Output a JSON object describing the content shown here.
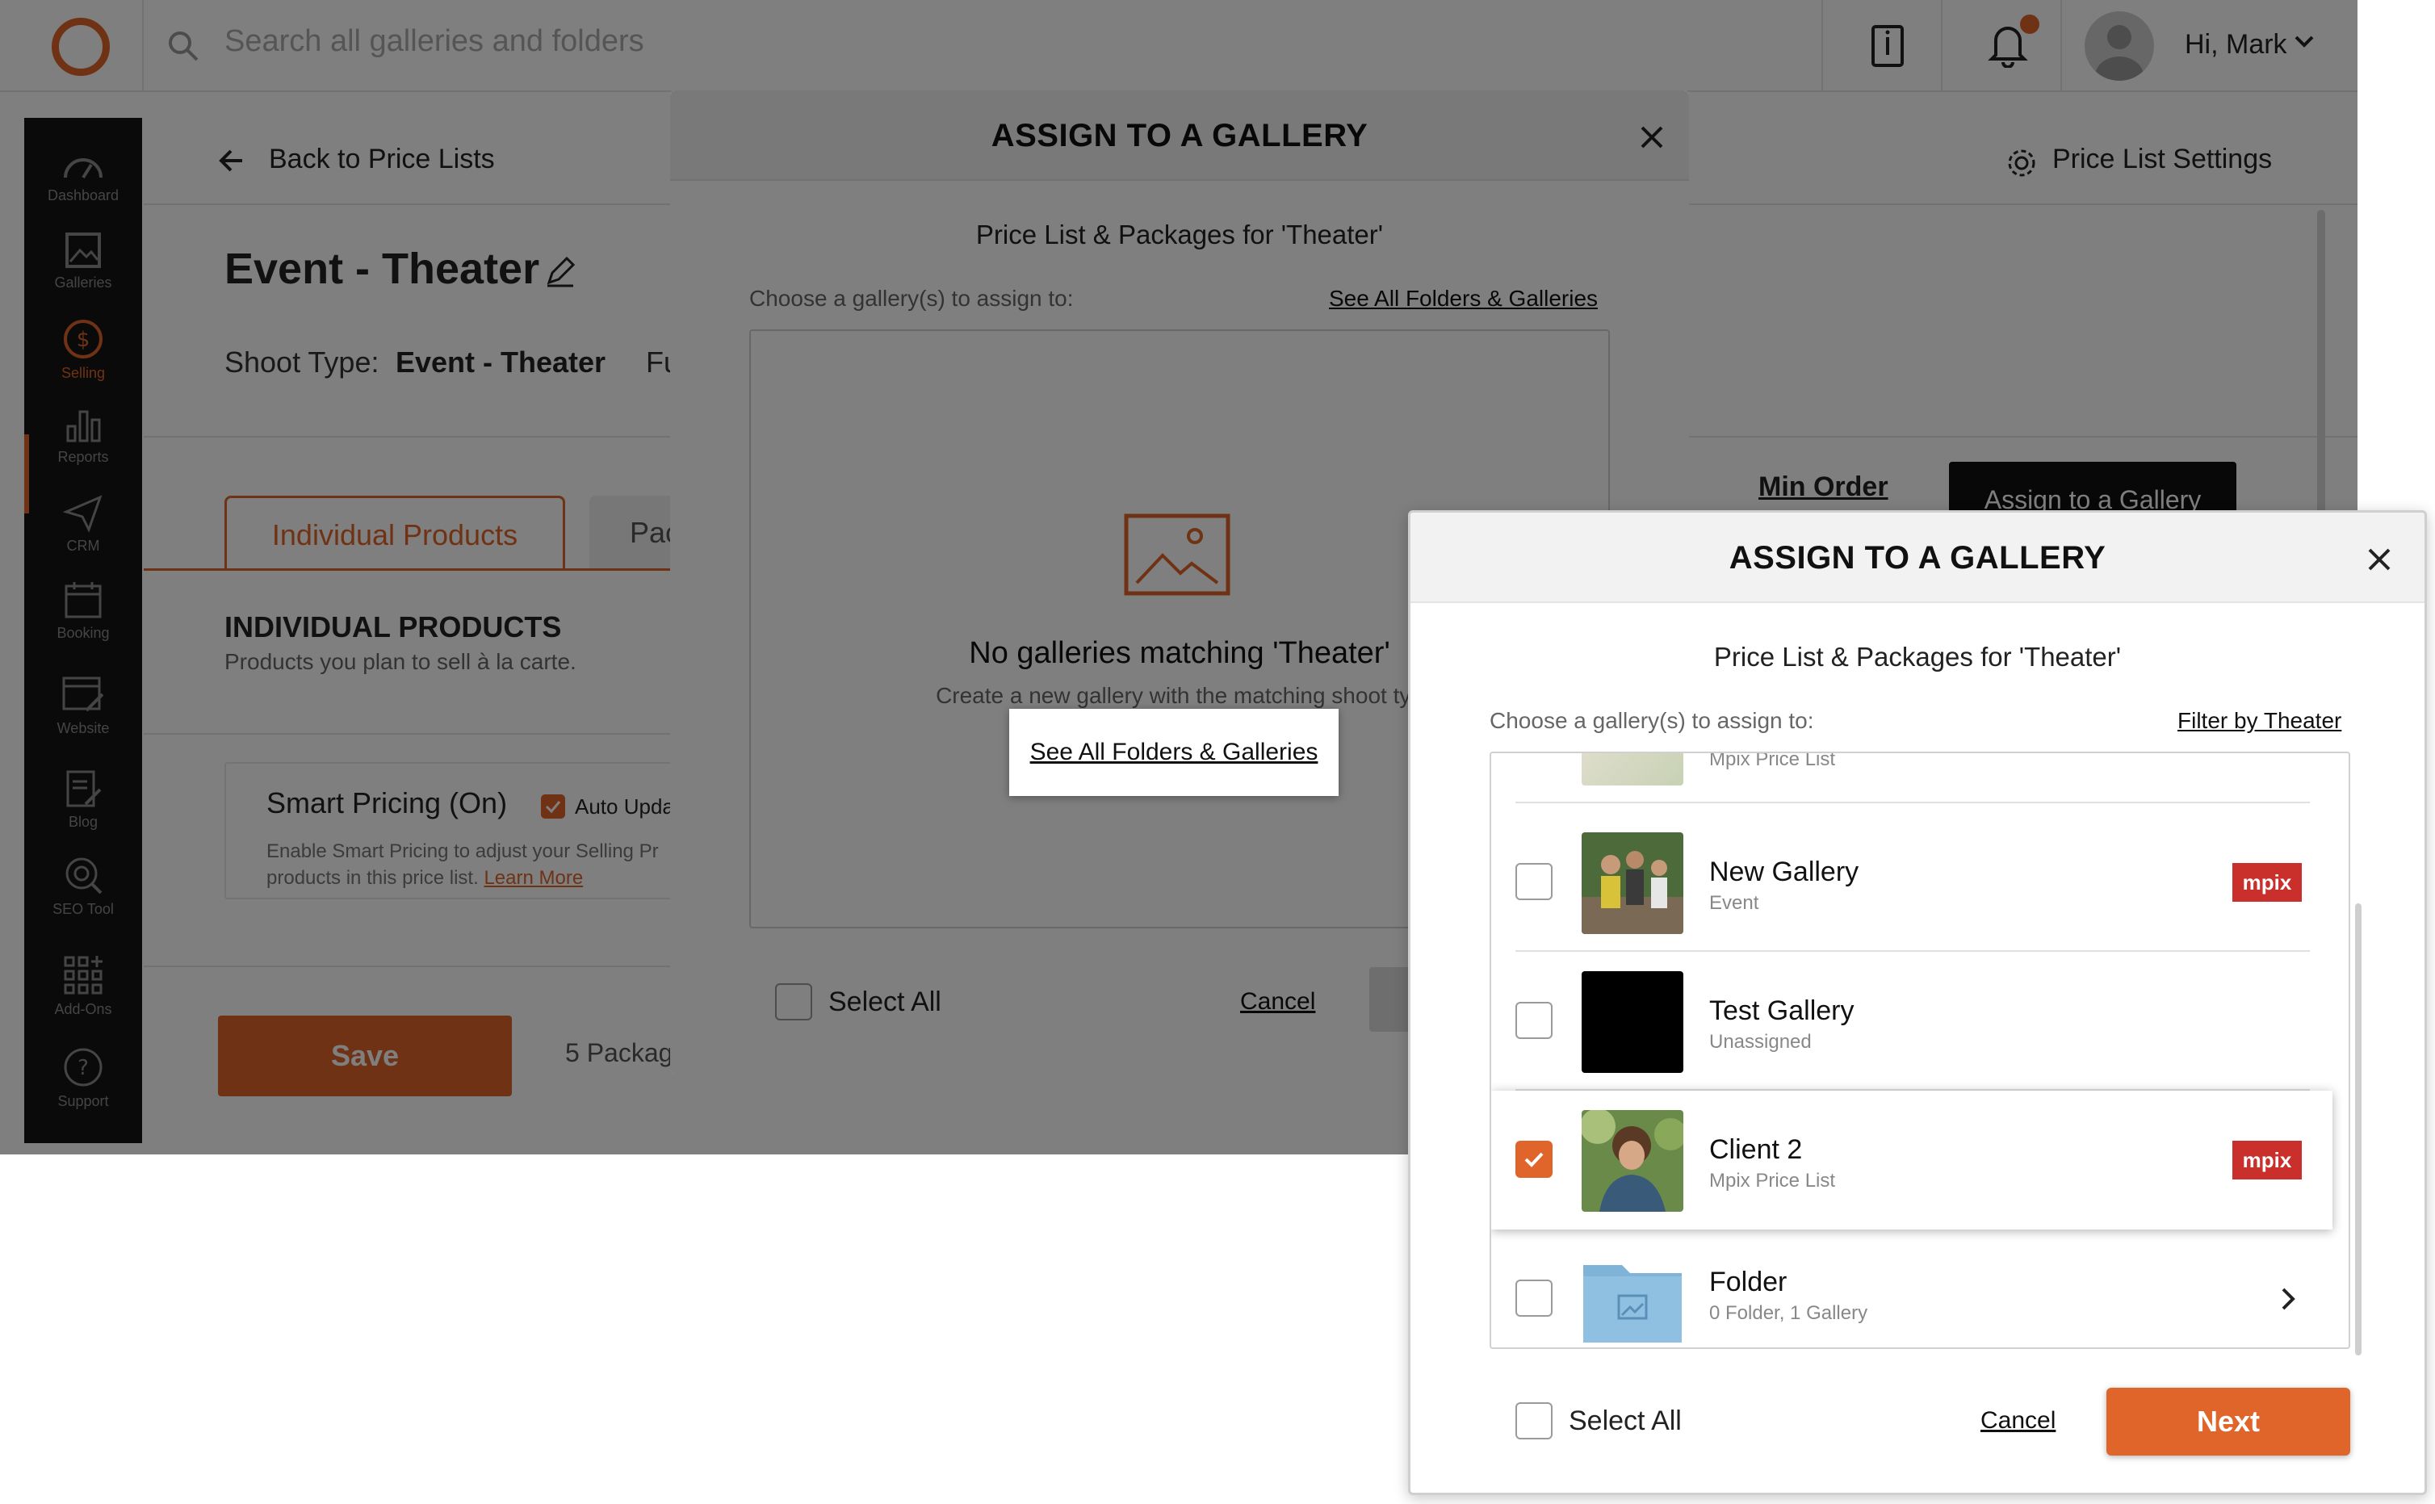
{
  "header": {
    "search_placeholder": "Search all galleries and folders",
    "greeting": "Hi, Mark"
  },
  "sidebar": {
    "items": [
      {
        "label": "Dashboard",
        "icon": "gauge-icon"
      },
      {
        "label": "Galleries",
        "icon": "image-icon"
      },
      {
        "label": "Selling",
        "icon": "dollar-icon",
        "active": true
      },
      {
        "label": "Reports",
        "icon": "bar-chart-icon"
      },
      {
        "label": "CRM",
        "icon": "paper-plane-icon"
      },
      {
        "label": "Booking",
        "icon": "calendar-icon"
      },
      {
        "label": "Website",
        "icon": "website-icon"
      },
      {
        "label": "Blog",
        "icon": "blog-icon"
      },
      {
        "label": "SEO Tool",
        "icon": "seo-icon"
      },
      {
        "label": "Add-Ons",
        "icon": "grid-plus-icon"
      },
      {
        "label": "Support",
        "icon": "help-icon"
      }
    ]
  },
  "page": {
    "back_label": "Back to Price Lists",
    "settings_label": "Price List Settings",
    "title": "Event - Theater",
    "shoot_type_label": "Shoot Type:",
    "shoot_type_value": "Event - Theater",
    "shoot_more": "Fu",
    "tab_individual": "Individual Products",
    "tab_packages": "Pac",
    "section_title": "INDIVIDUAL PRODUCTS",
    "section_sub": "Products you plan to sell à la carte.",
    "smart_pricing_title": "Smart Pricing (On)",
    "auto_update_label": "Auto Upda",
    "smart_pricing_desc": "Enable Smart Pricing to adjust your Selling Pr",
    "smart_pricing_desc2": "products in this price list.",
    "learn_more": "Learn More",
    "save_label": "Save",
    "packages_count": "5 Packag",
    "min_order": "Min Order",
    "assign_button": "Assign to a Gallery"
  },
  "modal_back": {
    "title": "ASSIGN TO A GALLERY",
    "subtitle": "Price List & Packages for 'Theater'",
    "choose_label": "Choose a gallery(s) to assign to:",
    "see_all_link": "See All Folders & Galleries",
    "empty_title": "No galleries matching 'Theater'",
    "empty_sub": "Create a new gallery with the matching shoot typ",
    "empty_button": "See All Folders & Galleries",
    "select_all": "Select All",
    "cancel": "Cancel"
  },
  "modal_front": {
    "title": "ASSIGN TO A GALLERY",
    "subtitle": "Price List & Packages for 'Theater'",
    "choose_label": "Choose a gallery(s) to assign to:",
    "filter_link": "Filter by Theater",
    "partial_row_sub": "Mpix Price List",
    "galleries": [
      {
        "name": "New Gallery",
        "sub": "Event",
        "badge": "mpix",
        "checked": false
      },
      {
        "name": "Test Gallery",
        "sub": "Unassigned",
        "badge": "",
        "checked": false
      },
      {
        "name": "Client 2",
        "sub": "Mpix Price List",
        "badge": "mpix",
        "checked": true
      },
      {
        "name": "Folder",
        "sub": "0 Folder, 1 Gallery",
        "badge": "",
        "checked": false
      }
    ],
    "select_all": "Select All",
    "cancel": "Cancel",
    "next": "Next"
  },
  "colors": {
    "accent": "#e0652a",
    "badge": "#c9302c",
    "sidebar_bg": "#151515"
  }
}
